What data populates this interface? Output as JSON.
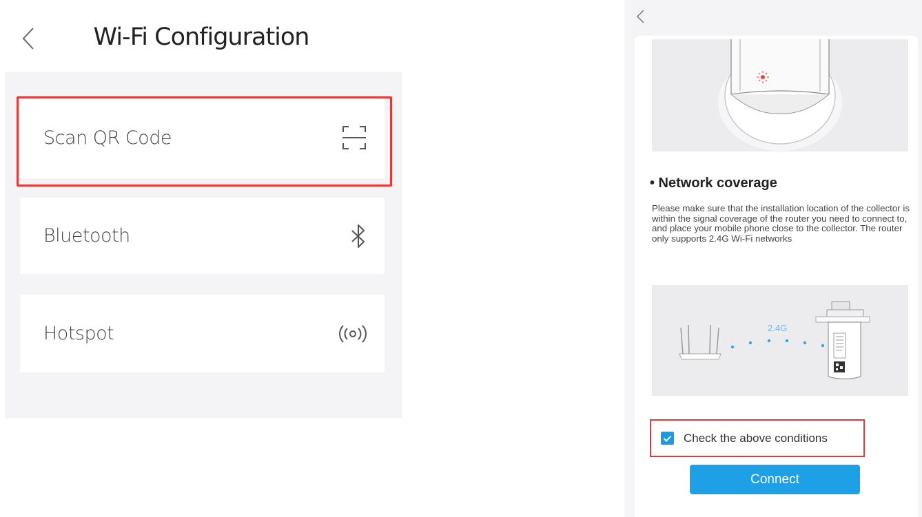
{
  "left": {
    "title": "Wi-Fi Configuration",
    "options": [
      {
        "label": "Scan QR Code",
        "icon": "scan-qr-icon"
      },
      {
        "label": "Bluetooth",
        "icon": "bluetooth-icon"
      },
      {
        "label": "Hotspot",
        "icon": "hotspot-icon"
      }
    ]
  },
  "right": {
    "section_title": "• Network coverage",
    "description": "Please make sure that the installation location of the collector is within the signal coverage of the router you need to connect to, and place your mobile phone close to the collector. The router only supports 2.4G Wi-Fi networks",
    "band_label": "2.4G",
    "checkbox_label": "Check the above conditions",
    "checkbox_checked": true,
    "connect_label": "Connect"
  },
  "colors": {
    "accent": "#1ea0e6",
    "highlight": "#e53935",
    "background": "#f4f4f6"
  }
}
